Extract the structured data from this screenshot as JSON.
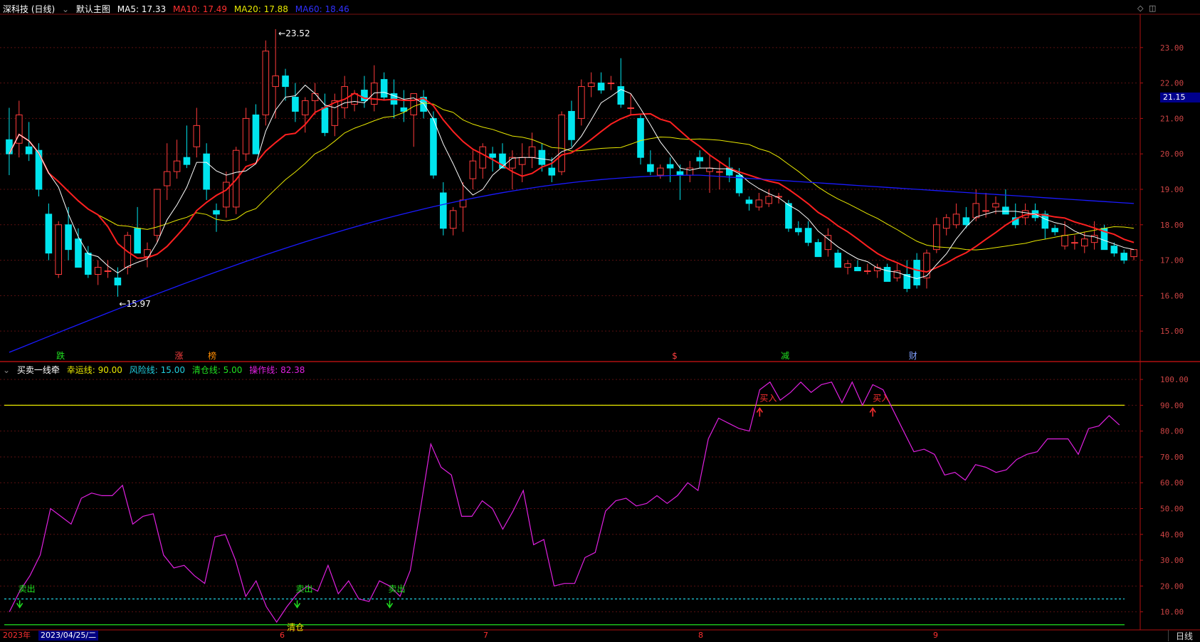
{
  "main_header": {
    "stock": "深科技 (日线)",
    "template": "默认主图",
    "ma5": "MA5: 17.33",
    "ma10": "MA10: 17.49",
    "ma20": "MA20: 17.88",
    "ma60": "MA60: 18.46"
  },
  "sub_header": {
    "indicator": "买卖一线牵",
    "lucky": "幸运线: 90.00",
    "risk": "风险线: 15.00",
    "clear": "清仓线: 5.00",
    "operate": "操作线: 82.38"
  },
  "price_tag": "21.15",
  "high_label": "23.52",
  "low_label": "15.97",
  "bottom": {
    "year": "2023年",
    "date": "2023/04/25/二",
    "months": [
      "6",
      "7",
      "8",
      "9"
    ],
    "period_button": "日线"
  },
  "colors": {
    "up": "#ff3b3b",
    "down": "#00e5ee",
    "ma5": "#ffffff",
    "ma10": "#ff2020",
    "ma20": "#e8e800",
    "ma60": "#1a1aff",
    "oscillator": "#e020e0",
    "lucky_line": "#e8e800",
    "risk_line": "#20d0e0",
    "clear_line": "#20e020",
    "grid": "#5a1010"
  },
  "chart_data": [
    {
      "type": "candlestick",
      "title": "深科技 (日线)",
      "ylim": [
        14.2,
        23.9
      ],
      "y_ticks": [
        15.0,
        16.0,
        17.0,
        18.0,
        19.0,
        20.0,
        21.0,
        22.0,
        23.0
      ],
      "event_markers": [
        "跌",
        "涨",
        "榜",
        "$",
        "减",
        "财"
      ],
      "ohlc": [
        [
          20.4,
          21.3,
          19.4,
          20.0
        ],
        [
          20.3,
          21.5,
          19.9,
          21.1
        ],
        [
          20.2,
          20.9,
          19.8,
          20.0
        ],
        [
          20.1,
          20.3,
          18.8,
          19.0
        ],
        [
          18.3,
          18.6,
          17.0,
          17.2
        ],
        [
          16.6,
          18.1,
          16.5,
          18.0
        ],
        [
          18.0,
          18.5,
          17.0,
          17.3
        ],
        [
          17.6,
          17.9,
          16.8,
          16.8
        ],
        [
          17.2,
          17.4,
          16.5,
          16.6
        ],
        [
          16.6,
          17.0,
          16.3,
          16.8
        ],
        [
          16.7,
          17.0,
          16.5,
          16.7
        ],
        [
          16.5,
          16.8,
          15.97,
          16.3
        ],
        [
          16.8,
          17.8,
          16.6,
          17.7
        ],
        [
          17.9,
          18.5,
          17.2,
          17.2
        ],
        [
          17.1,
          17.5,
          16.8,
          17.3
        ],
        [
          17.7,
          19.0,
          17.5,
          19.0
        ],
        [
          19.1,
          20.3,
          18.7,
          19.5
        ],
        [
          19.5,
          20.4,
          19.3,
          19.8
        ],
        [
          19.9,
          20.8,
          19.6,
          19.7
        ],
        [
          20.2,
          21.3,
          19.9,
          20.8
        ],
        [
          20.0,
          20.3,
          18.7,
          19.0
        ],
        [
          18.4,
          18.6,
          17.8,
          18.3
        ],
        [
          18.5,
          19.5,
          18.2,
          19.2
        ],
        [
          18.5,
          20.2,
          18.3,
          20.1
        ],
        [
          20.0,
          21.3,
          19.8,
          21.0
        ],
        [
          21.1,
          21.4,
          20.0,
          20.0
        ],
        [
          21.1,
          23.2,
          20.8,
          22.9
        ],
        [
          21.9,
          23.52,
          21.0,
          22.2
        ],
        [
          22.2,
          22.4,
          21.5,
          21.9
        ],
        [
          21.6,
          22.0,
          20.9,
          21.2
        ],
        [
          21.1,
          21.6,
          20.6,
          21.5
        ],
        [
          21.5,
          22.0,
          21.1,
          21.7
        ],
        [
          21.3,
          21.7,
          20.5,
          20.6
        ],
        [
          20.8,
          21.7,
          20.5,
          21.5
        ],
        [
          21.3,
          22.2,
          21.0,
          21.9
        ],
        [
          21.4,
          21.8,
          21.2,
          21.7
        ],
        [
          21.8,
          22.2,
          21.3,
          21.5
        ],
        [
          21.4,
          22.5,
          21.2,
          22.0
        ],
        [
          22.1,
          22.3,
          21.5,
          21.6
        ],
        [
          21.7,
          22.1,
          21.0,
          21.4
        ],
        [
          21.3,
          21.8,
          20.9,
          21.2
        ],
        [
          21.1,
          21.4,
          20.2,
          21.7
        ],
        [
          21.6,
          21.8,
          21.0,
          21.2
        ],
        [
          21.0,
          21.2,
          19.3,
          19.4
        ],
        [
          18.9,
          19.2,
          17.7,
          17.9
        ],
        [
          17.9,
          18.5,
          17.7,
          18.4
        ],
        [
          18.5,
          19.2,
          17.8,
          18.7
        ],
        [
          19.3,
          20.1,
          19.0,
          19.8
        ],
        [
          19.6,
          20.3,
          19.3,
          20.2
        ],
        [
          20.0,
          20.2,
          19.5,
          19.9
        ],
        [
          20.0,
          20.3,
          19.6,
          19.6
        ],
        [
          19.6,
          20.1,
          19.0,
          19.9
        ],
        [
          19.7,
          20.3,
          19.2,
          19.9
        ],
        [
          19.9,
          20.6,
          19.6,
          20.2
        ],
        [
          20.1,
          20.3,
          19.5,
          19.7
        ],
        [
          19.6,
          19.9,
          19.2,
          19.4
        ],
        [
          19.5,
          21.2,
          19.4,
          21.1
        ],
        [
          21.2,
          21.5,
          20.2,
          20.4
        ],
        [
          21.0,
          22.1,
          20.8,
          21.9
        ],
        [
          21.9,
          22.3,
          21.6,
          22.0
        ],
        [
          22.0,
          22.3,
          21.7,
          21.8
        ],
        [
          22.0,
          22.2,
          21.8,
          22.0
        ],
        [
          21.9,
          22.7,
          21.3,
          21.4
        ],
        [
          21.3,
          21.7,
          21.1,
          21.3
        ],
        [
          21.0,
          21.1,
          19.7,
          19.9
        ],
        [
          19.7,
          20.1,
          19.4,
          19.5
        ],
        [
          19.4,
          19.7,
          19.3,
          19.6
        ],
        [
          19.7,
          19.9,
          19.2,
          19.6
        ],
        [
          19.5,
          19.7,
          18.7,
          19.4
        ],
        [
          19.4,
          19.8,
          19.2,
          19.6
        ],
        [
          19.9,
          20.1,
          19.6,
          19.8
        ],
        [
          19.5,
          20.0,
          18.9,
          19.6
        ],
        [
          19.5,
          19.8,
          19.0,
          19.5
        ],
        [
          19.6,
          19.9,
          19.2,
          19.4
        ],
        [
          19.4,
          19.6,
          18.8,
          18.9
        ],
        [
          18.7,
          18.8,
          18.4,
          18.6
        ],
        [
          18.5,
          18.9,
          18.4,
          18.7
        ],
        [
          18.6,
          19.0,
          18.5,
          18.8
        ],
        [
          18.8,
          18.9,
          18.6,
          18.8
        ],
        [
          18.6,
          18.7,
          17.8,
          17.9
        ],
        [
          17.9,
          18.1,
          17.7,
          17.8
        ],
        [
          17.9,
          18.1,
          17.4,
          17.5
        ],
        [
          17.5,
          17.6,
          17.1,
          17.1
        ],
        [
          17.3,
          17.9,
          17.1,
          17.7
        ],
        [
          17.2,
          17.3,
          16.8,
          16.8
        ],
        [
          16.8,
          17.0,
          16.6,
          16.9
        ],
        [
          16.8,
          17.0,
          16.7,
          16.7
        ],
        [
          16.7,
          16.9,
          16.6,
          16.7
        ],
        [
          16.7,
          16.9,
          16.5,
          16.8
        ],
        [
          16.8,
          16.9,
          16.4,
          16.4
        ],
        [
          16.5,
          16.9,
          16.4,
          16.7
        ],
        [
          16.6,
          17.0,
          16.1,
          16.2
        ],
        [
          17.0,
          17.2,
          16.2,
          16.3
        ],
        [
          16.5,
          17.3,
          16.2,
          17.2
        ],
        [
          17.3,
          18.2,
          17.2,
          18.0
        ],
        [
          17.9,
          18.3,
          17.7,
          18.2
        ],
        [
          18.0,
          18.6,
          17.9,
          18.3
        ],
        [
          18.2,
          18.5,
          17.9,
          18.0
        ],
        [
          18.2,
          19.0,
          18.1,
          18.6
        ],
        [
          18.4,
          18.9,
          18.2,
          18.4
        ],
        [
          18.5,
          18.8,
          18.3,
          18.6
        ],
        [
          18.5,
          19.0,
          18.4,
          18.3
        ],
        [
          18.2,
          18.6,
          17.9,
          18.0
        ],
        [
          18.2,
          18.6,
          18.0,
          18.4
        ],
        [
          18.4,
          18.6,
          18.1,
          18.2
        ],
        [
          18.3,
          18.4,
          17.6,
          17.9
        ],
        [
          17.9,
          18.0,
          17.7,
          17.8
        ],
        [
          17.4,
          18.1,
          17.3,
          17.7
        ],
        [
          17.5,
          17.7,
          17.3,
          17.5
        ],
        [
          17.4,
          17.8,
          17.2,
          17.6
        ],
        [
          17.5,
          18.1,
          17.3,
          17.7
        ],
        [
          17.9,
          18.0,
          17.4,
          17.3
        ],
        [
          17.4,
          17.5,
          17.1,
          17.2
        ],
        [
          17.2,
          17.3,
          16.9,
          17.0
        ],
        [
          17.1,
          17.3,
          17.0,
          17.3
        ]
      ],
      "ma60": [
        14.4,
        19.4,
        18.6
      ]
    },
    {
      "type": "line",
      "title": "买卖一线牵",
      "ylim": [
        3,
        105
      ],
      "y_ticks": [
        10,
        20,
        30,
        40,
        50,
        60,
        70,
        80,
        90,
        100
      ],
      "reference_lines": [
        {
          "name": "幸运线",
          "value": 90
        },
        {
          "name": "风险线",
          "value": 15
        },
        {
          "name": "清仓线",
          "value": 5
        }
      ],
      "series": [
        {
          "name": "操作线",
          "values": [
            10,
            18,
            24,
            32,
            50,
            47,
            44,
            54,
            56,
            55,
            55,
            59,
            44,
            47,
            48,
            32,
            27,
            28,
            24,
            21,
            39,
            40,
            30,
            16,
            22,
            12,
            6,
            12,
            17,
            20,
            18,
            28,
            17,
            22,
            15,
            14,
            22,
            20,
            16,
            26,
            50,
            75,
            66,
            63,
            47,
            47,
            53,
            50,
            42,
            49,
            57,
            36,
            38,
            20,
            21,
            21,
            31,
            33,
            49,
            53,
            54,
            51,
            52,
            55,
            52,
            55,
            60,
            57,
            77,
            85,
            83,
            81,
            80,
            96,
            99,
            92,
            95,
            99,
            95,
            98,
            99,
            91,
            99,
            90,
            98,
            96,
            88,
            80,
            72,
            73,
            71,
            63,
            64,
            61,
            67,
            66,
            64,
            65,
            69,
            71,
            72,
            77,
            77,
            77,
            71,
            81,
            82,
            86,
            82.38
          ]
        }
      ],
      "signals": [
        {
          "label": "卖出",
          "x_index": 1,
          "type": "sell"
        },
        {
          "label": "卖出",
          "x_index": 28,
          "type": "sell"
        },
        {
          "label": "卖出",
          "x_index": 37,
          "type": "sell"
        },
        {
          "label": "清仓",
          "x_index": 27,
          "type": "clear"
        },
        {
          "label": "买入",
          "x_index": 73,
          "type": "buy"
        },
        {
          "label": "买入",
          "x_index": 84,
          "type": "buy"
        }
      ]
    }
  ]
}
